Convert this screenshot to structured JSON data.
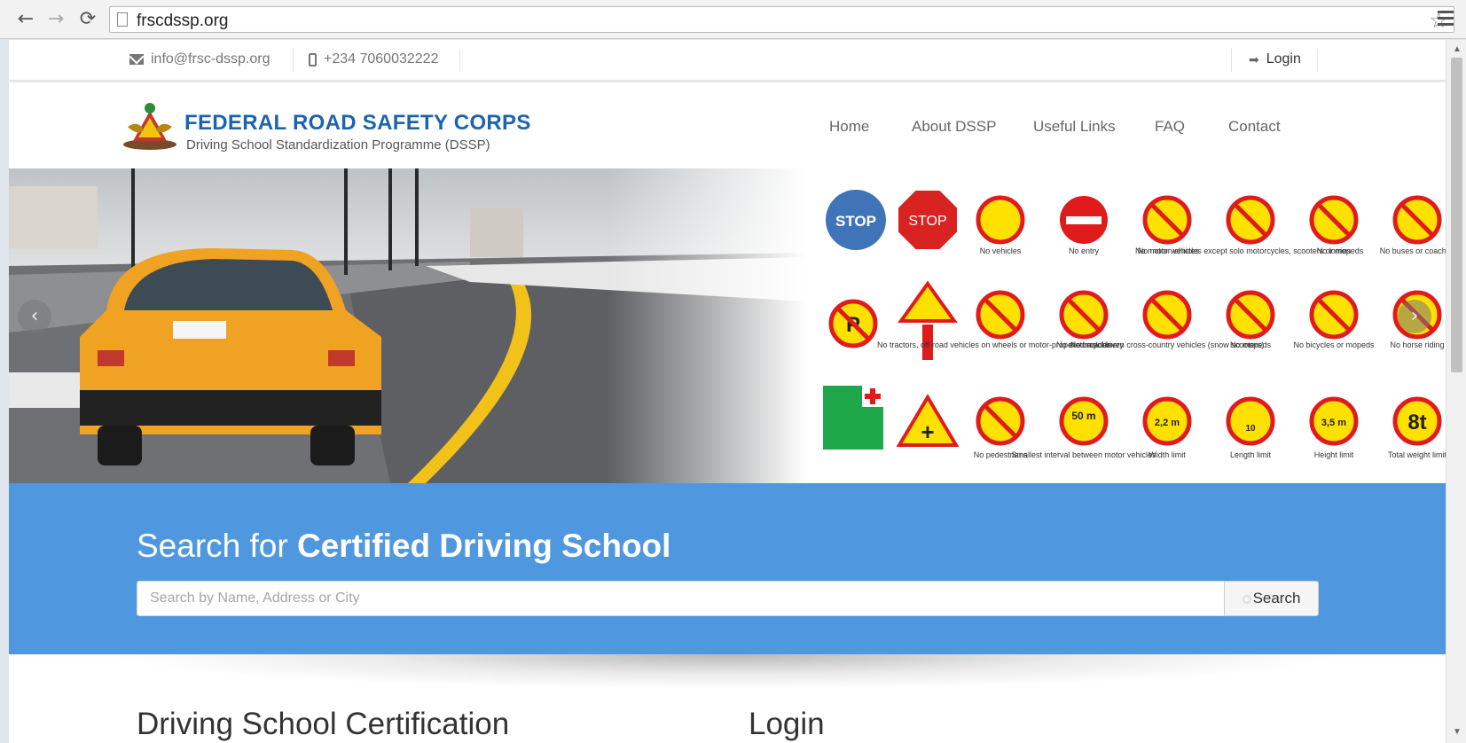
{
  "browser": {
    "url": "frscdssp.org"
  },
  "topbar": {
    "email": "info@frsc-dssp.org",
    "phone": "+234 7060032222",
    "login_label": "Login"
  },
  "header": {
    "title": "FEDERAL ROAD SAFETY CORPS",
    "subtitle": "Driving School Standardization Programme (DSSP)",
    "nav": [
      "Home",
      "About DSSP",
      "Useful Links",
      "FAQ",
      "Contact"
    ]
  },
  "hero": {
    "signs": {
      "stop1": "STOP",
      "stop2": "STOP",
      "captions": [
        "No vehicles",
        "No entry",
        "No motor vehicles",
        "No motor vehicles except solo motorcycles, scooters or mopeds",
        "No lorries",
        "No buses or coaches",
        "No tractors, off-road vehicles on wheels or motor-propelled machinery",
        "No motorcycles",
        "No track-driven cross-country vehicles (snow scooters)",
        "No mopeds",
        "No bicycles or mopeds",
        "No horse riding",
        "No pedestrians",
        "Smallest interval between motor vehicles",
        "Width limit",
        "Length limit",
        "Height limit",
        "Total weight limit"
      ],
      "width": "2,2 m",
      "height": "3,5 m",
      "weight": "8t",
      "interval": "50 m",
      "length": "10"
    }
  },
  "search": {
    "title_light": "Search for ",
    "title_bold": "Certified Driving School",
    "placeholder": "Search by Name, Address or City",
    "button_label": "Search"
  },
  "sections": {
    "certification": "Driving School Certification",
    "login": "Login"
  },
  "colors": {
    "brand_blue": "#1b64b0",
    "search_band": "#4f98e0",
    "sign_red": "#e01b1b",
    "sign_yellow": "#ffe100"
  }
}
